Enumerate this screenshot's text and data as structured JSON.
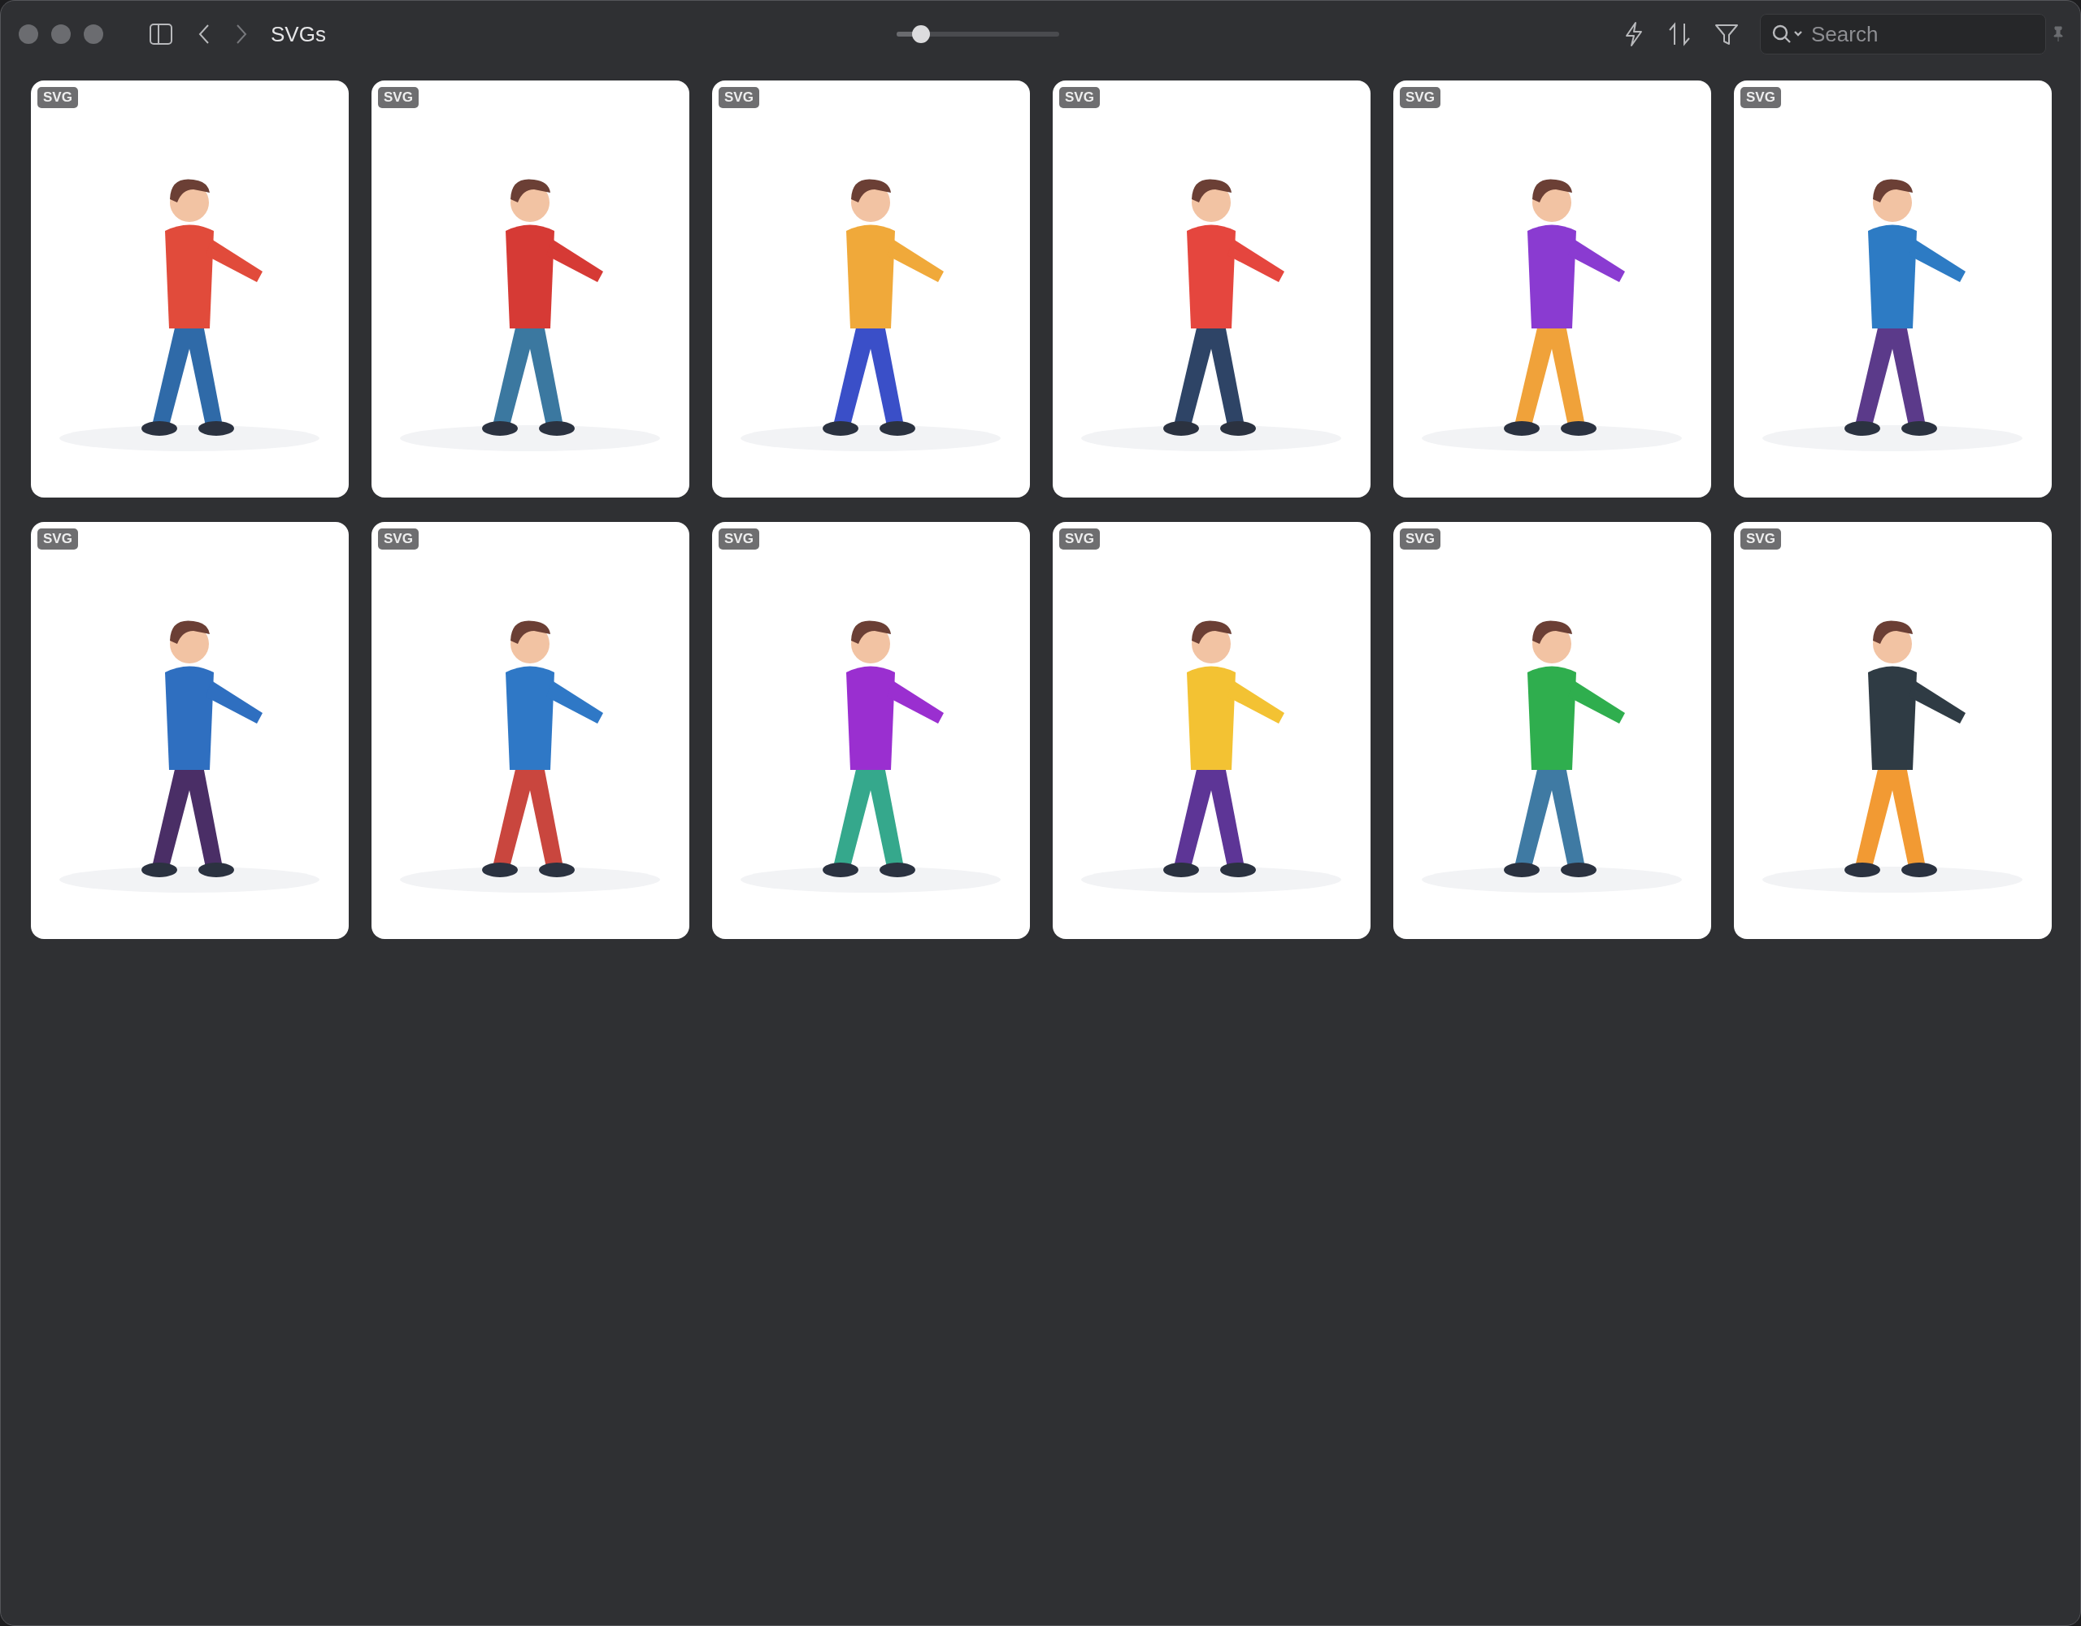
{
  "window": {
    "title": "SVGs"
  },
  "zoom_slider": {
    "level": 0.15
  },
  "search": {
    "placeholder": "Search"
  },
  "cards": [
    {
      "badge": "SVG"
    },
    {
      "badge": "SVG"
    },
    {
      "badge": "SVG"
    },
    {
      "badge": "SVG"
    },
    {
      "badge": "SVG"
    },
    {
      "badge": "SVG"
    },
    {
      "badge": "SVG"
    },
    {
      "badge": "SVG"
    },
    {
      "badge": "SVG"
    },
    {
      "badge": "SVG"
    },
    {
      "badge": "SVG"
    },
    {
      "badge": "SVG"
    }
  ]
}
